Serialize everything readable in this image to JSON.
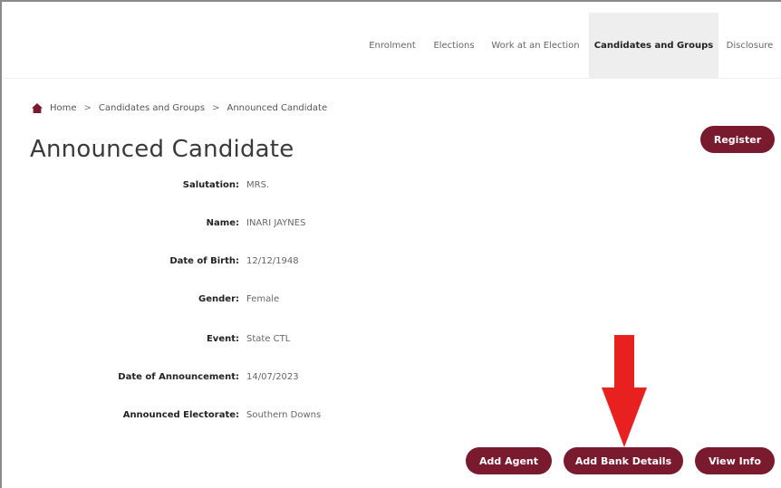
{
  "nav": {
    "items": [
      {
        "label": "Enrolment",
        "active": false
      },
      {
        "label": "Elections",
        "active": false
      },
      {
        "label": "Work at an Election",
        "active": false
      },
      {
        "label": "Candidates and Groups",
        "active": true
      },
      {
        "label": "Disclosure",
        "active": false
      }
    ]
  },
  "breadcrumb": {
    "home": "Home",
    "separator": ">",
    "section": "Candidates and Groups",
    "current": "Announced Candidate"
  },
  "page": {
    "title": "Announced Candidate"
  },
  "actions": {
    "register": "Register",
    "add_agent": "Add Agent",
    "add_bank_details": "Add Bank Details",
    "view_info": "View Info"
  },
  "details": [
    {
      "label": "Salutation:",
      "value": "MRS."
    },
    {
      "label": "Name:",
      "value": "INARI JAYNES"
    },
    {
      "label": "Date of Birth:",
      "value": "12/12/1948"
    },
    {
      "label": "Gender:",
      "value": "Female"
    },
    {
      "label": "Event:",
      "value": "State CTL"
    },
    {
      "label": "Date of Announcement:",
      "value": "14/07/2023"
    },
    {
      "label": "Announced Electorate:",
      "value": "Southern Downs"
    }
  ],
  "colors": {
    "accent": "#7a1a2e",
    "arrow": "#e8201f",
    "nav_active_bg": "#eeeeee"
  },
  "icons": {
    "home": "home-icon",
    "annotation": "red-arrow-down"
  }
}
